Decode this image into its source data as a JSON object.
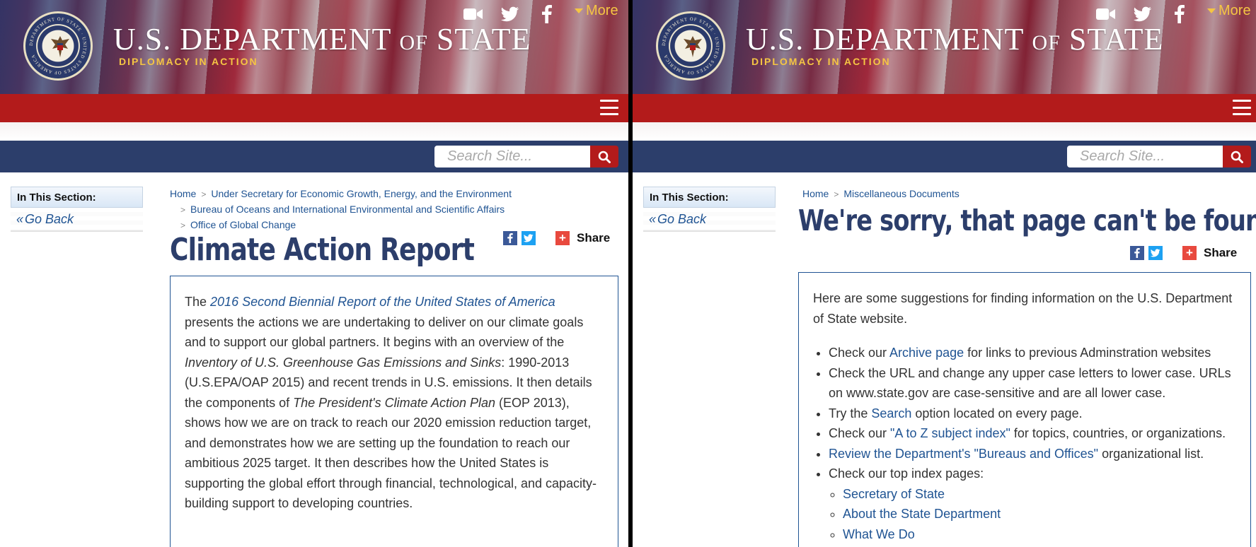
{
  "header": {
    "title_pre": "U.S. DEPARTMENT",
    "title_of": "OF",
    "title_post": "STATE",
    "tagline": "DIPLOMACY IN ACTION",
    "more_label": "More",
    "seal_text": "DEPARTMENT OF STATE · UNITED STATES OF AMERICA"
  },
  "search": {
    "placeholder": "Search Site..."
  },
  "sidebar": {
    "title": "In This Section:",
    "back_symbol": "«",
    "back_label": "Go Back"
  },
  "share": {
    "label": "Share",
    "plus": "+"
  },
  "left": {
    "breadcrumb": {
      "home": "Home",
      "item1": "Under Secretary for Economic Growth, Energy, and the Environment",
      "item2": "Bureau of Oceans and International Environmental and Scientific Affairs",
      "item3": "Office of Global Change",
      "sep": ">"
    },
    "title": "Climate Action Report",
    "body": {
      "t1": "The ",
      "link1": "2016 Second Biennial Report of the United States of America",
      "t2": " presents the actions we are undertaking to deliver on our climate goals and to support our global partners. It begins with an overview of the ",
      "em1": "Inventory of U.S. Greenhouse Gas Emissions and Sinks",
      "t3": ": 1990-2013 (U.S.EPA/OAP 2015) and recent trends in U.S. emissions. It then details the components of ",
      "em2": "The President's Climate Action Plan",
      "t4": " (EOP 2013), shows how we are on track to reach our 2020 emission reduction target, and demonstrates how we are setting up the foundation to reach our ambitious 2025 target. It then describes how the United States is supporting the global effort through financial, technological, and capacity-building support to developing countries."
    }
  },
  "right": {
    "breadcrumb": {
      "home": "Home",
      "item1": "Miscellaneous Documents",
      "sep": ">"
    },
    "title": "We're sorry, that page can't be found.",
    "intro": "Here are some suggestions for finding information on the U.S. Department of State website.",
    "list": {
      "i1_pre": "Check our ",
      "i1_link": "Archive page",
      "i1_post": " for links to previous Adminstration websites",
      "i2": "Check the URL and change any upper case letters to lower case. URLs on www.state.gov are case-sensitive and are all lower case.",
      "i3_pre": "Try the ",
      "i3_link": "Search",
      "i3_post": " option located on every page.",
      "i4_pre": "Check our ",
      "i4_link": "\"A to Z subject index\"",
      "i4_post": " for topics, countries, or organizations.",
      "i5_link": "Review the Department's \"Bureaus and Offices\"",
      "i5_post": " organizational list.",
      "i6": "Check our top index pages:",
      "sub1": "Secretary of State",
      "sub2": "About the State Department",
      "sub3": "What We Do"
    }
  },
  "colors": {
    "red": "#b31b1b",
    "navy": "#2c3e6b",
    "gold": "#f5c543",
    "link": "#205493"
  }
}
